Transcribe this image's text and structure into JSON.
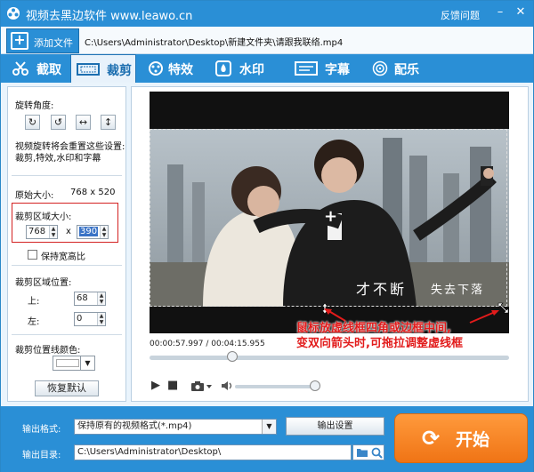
{
  "titlebar": {
    "title": "视频去黑边软件 www.leawo.cn",
    "feedback": "反馈问题",
    "min_symbol": "–",
    "close_symbol": "✕"
  },
  "filebar": {
    "add_label": "添加文件",
    "path": "C:\\Users\\Administrator\\Desktop\\新建文件夹\\请跟我联络.mp4"
  },
  "tabs": [
    {
      "label": "截取",
      "icon": "scissors-icon"
    },
    {
      "label": "裁剪",
      "icon": "crop-icon",
      "active": true
    },
    {
      "label": "特效",
      "icon": "effects-icon"
    },
    {
      "label": "水印",
      "icon": "watermark-icon"
    },
    {
      "label": "字幕",
      "icon": "subtitle-icon"
    },
    {
      "label": "配乐",
      "icon": "music-icon"
    }
  ],
  "left": {
    "rotation_label": "旋转角度:",
    "rotate_note_line1": "视频旋转将会重置这些设置:",
    "rotate_note_line2": "裁剪,特效,水印和字幕",
    "original_size_label": "原始大小:",
    "original_size_value": "768 x 520",
    "crop_size_label": "裁剪区域大小:",
    "crop_width": "768",
    "x_sep": "x",
    "crop_height": "390",
    "keep_ratio_label": "保持宽高比",
    "crop_pos_label": "裁剪区域位置:",
    "top_label": "上:",
    "top_value": "68",
    "left_label": "左:",
    "left_value": "0",
    "line_color_label": "裁剪位置线颜色:",
    "reset_label": "恢复默认"
  },
  "preview": {
    "subtitle_main": "才不断",
    "subtitle_sub": "失去下落",
    "annotation_line1": "鼠标放虚线框四角或边框中间,",
    "annotation_line2": "变双向箭头时,可拖拉调整虚线框",
    "timecode": "00:00:57.997 / 00:04:15.955",
    "progress_fraction": 0.23,
    "volume_fraction": 0.96
  },
  "bottom": {
    "format_label": "输出格式:",
    "format_value": "保持原有的视频格式(*.mp4)",
    "settings_label": "输出设置",
    "dir_label": "输出目录:",
    "dir_value": "C:\\Users\\Administrator\\Desktop\\",
    "start_label": "开始"
  },
  "colors": {
    "accent": "#2a8fd6",
    "start": "#f07415",
    "annotation": "#e21b1b"
  }
}
